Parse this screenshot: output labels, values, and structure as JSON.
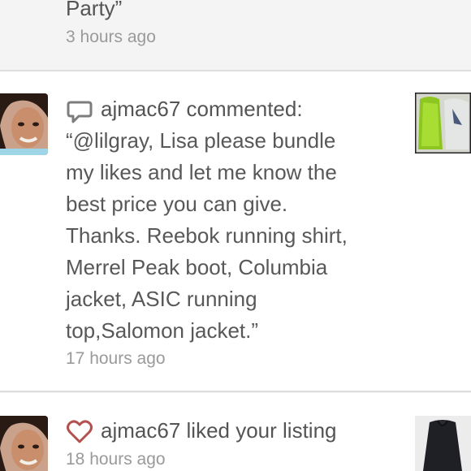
{
  "feed": {
    "top_item": {
      "title_tail": "Party”",
      "time": "3 hours ago"
    },
    "comment_item": {
      "username": "ajmac67",
      "action": "commented:",
      "comment_lines": [
        "“@lilgray, Lisa please bundle",
        "my likes and let me know the",
        "best price you can give.",
        "Thanks. Reebok running shirt,",
        "Merrel Peak boot, Columbia",
        "jacket, ASIC running",
        "top,Salomon jacket.”"
      ],
      "time": "17 hours ago",
      "icon": "comment-bubble-icon",
      "thumbnail": "green-vest-listing"
    },
    "like_item": {
      "username": "ajmac67",
      "action": "liked your listing",
      "time": "18 hours ago",
      "icon": "heart-icon",
      "thumbnail": "black-jacket-listing"
    }
  },
  "colors": {
    "text": "#545454",
    "timestamp": "#9a9a9a",
    "divider": "#dedede",
    "icon_accent": "#b4504d"
  }
}
